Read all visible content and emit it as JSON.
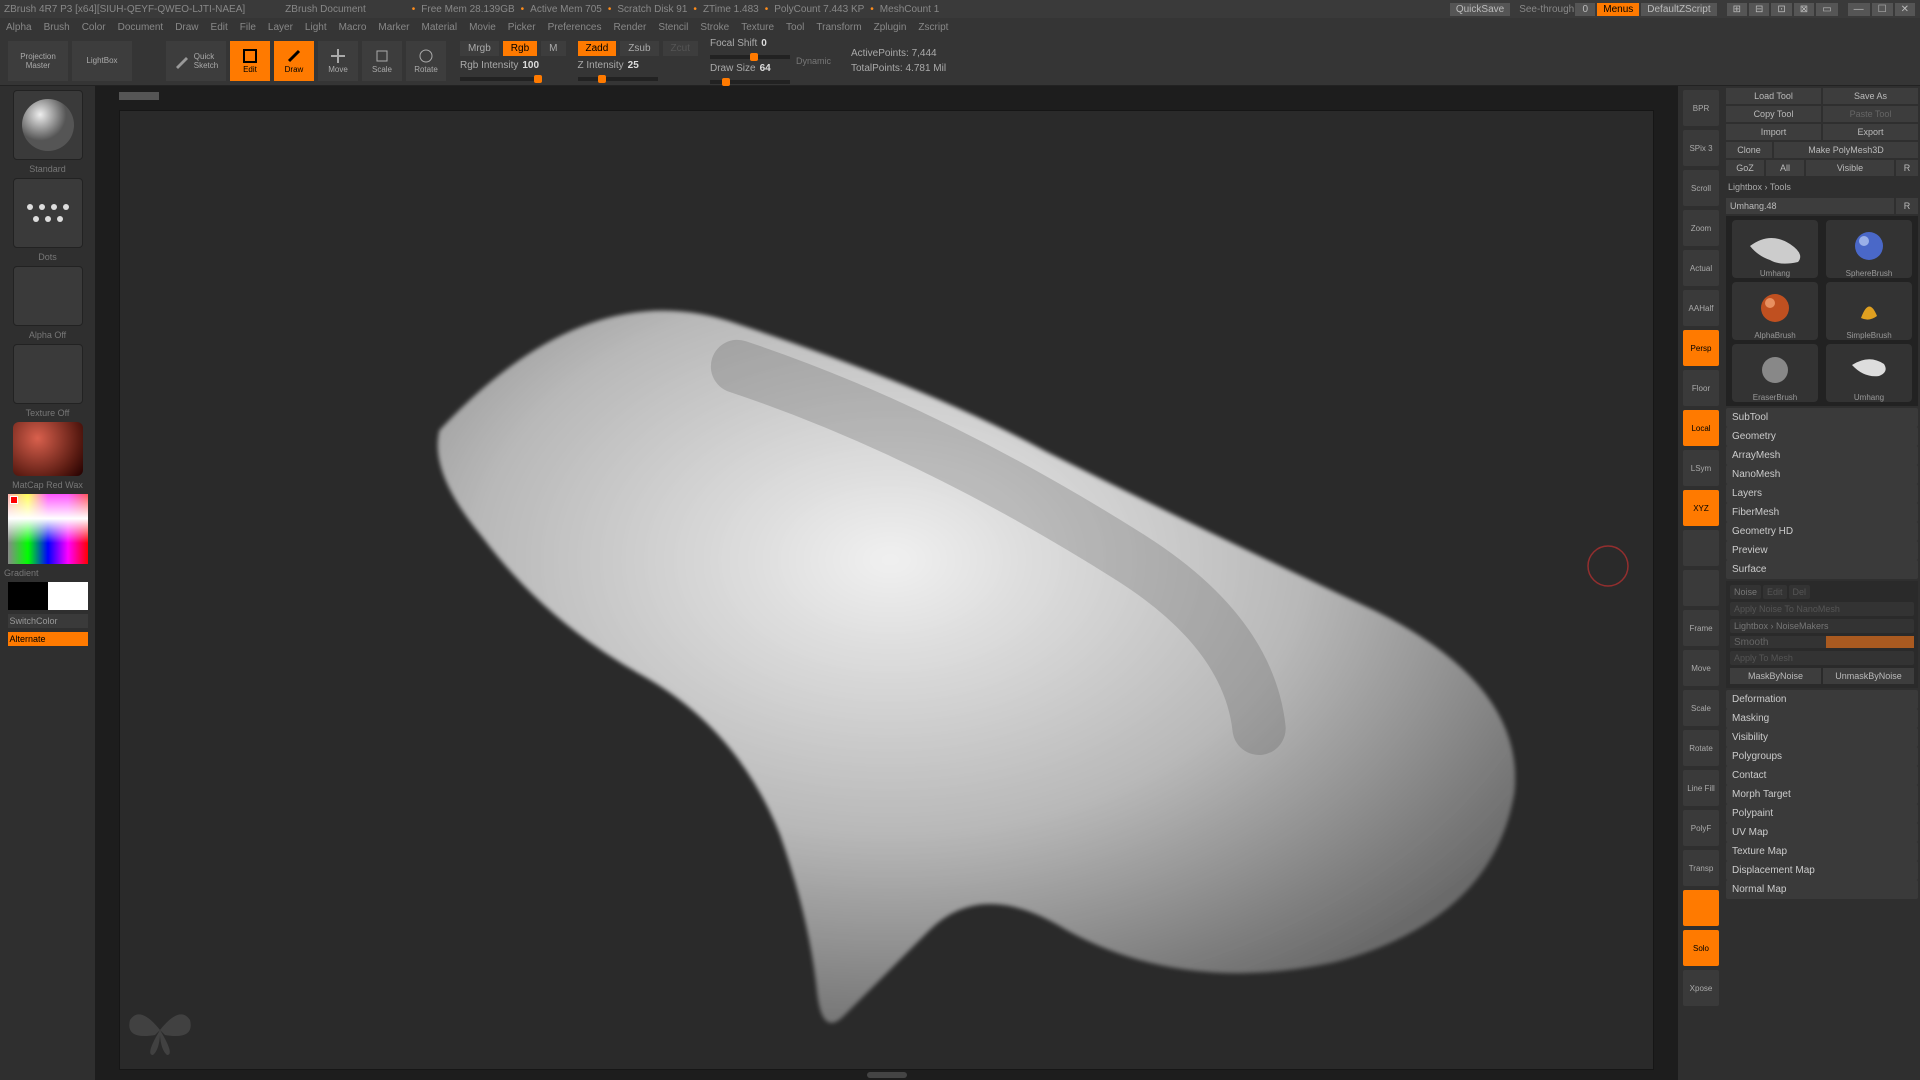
{
  "title": {
    "app": "ZBrush 4R7 P3 [x64][SIUH-QEYF-QWEO-LJTI-NAEA]",
    "doc": "ZBrush Document",
    "stats": [
      "Free Mem 28.139GB",
      "Active Mem 705",
      "Scratch Disk 91",
      "ZTime 1.483",
      "PolyCount 7.443 KP",
      "MeshCount 1"
    ]
  },
  "top_right": {
    "quicksave": "QuickSave",
    "seethrough": "See-through",
    "seethrough_val": "0",
    "menus": "Menus",
    "script": "DefaultZScript"
  },
  "menus": [
    "Alpha",
    "Brush",
    "Color",
    "Document",
    "Draw",
    "Edit",
    "File",
    "Layer",
    "Light",
    "Macro",
    "Marker",
    "Material",
    "Movie",
    "Picker",
    "Preferences",
    "Render",
    "Stencil",
    "Stroke",
    "Texture",
    "Tool",
    "Transform",
    "Zplugin",
    "Zscript"
  ],
  "toolbar": {
    "projection": "Projection\nMaster",
    "lightbox": "LightBox",
    "quicksketch": "Quick\nSketch",
    "edit": "Edit",
    "draw": "Draw",
    "move": "Move",
    "scale": "Scale",
    "rotate": "Rotate",
    "mrgb": "Mrgb",
    "rgb": "Rgb",
    "m": "M",
    "rgb_int": "Rgb Intensity",
    "rgb_int_val": "100",
    "zadd": "Zadd",
    "zsub": "Zsub",
    "zcut": "Zcut",
    "z_int": "Z Intensity",
    "z_int_val": "25",
    "focal": "Focal Shift",
    "focal_val": "0",
    "draw_size": "Draw Size",
    "draw_size_val": "64",
    "dynamic": "Dynamic",
    "active": "ActivePoints:",
    "active_val": "7,444",
    "total": "TotalPoints:",
    "total_val": "4.781 Mil"
  },
  "left": {
    "brush": "Standard",
    "stroke": "Dots",
    "alpha": "Alpha Off",
    "texture": "Texture Off",
    "material": "MatCap Red Wax",
    "gradient": "Gradient",
    "switchcolor": "SwitchColor",
    "alternate": "Alternate"
  },
  "rstrip": [
    "BPR",
    "SPix 3",
    "Scroll",
    "Zoom",
    "Actual",
    "AAHalf",
    "Persp",
    "Floor",
    "Local",
    "LSym",
    "XYZ",
    "",
    "",
    "Frame",
    "Move",
    "Scale",
    "Rotate",
    "Line Fill",
    "PolyF",
    "Transp",
    "",
    "Solo",
    "Xpose"
  ],
  "rstrip_on": [
    false,
    false,
    false,
    false,
    false,
    false,
    true,
    false,
    true,
    false,
    true,
    false,
    false,
    false,
    false,
    false,
    false,
    false,
    false,
    false,
    true,
    true,
    false
  ],
  "panel": {
    "load": "Load Tool",
    "saveas": "Save As",
    "copy": "Copy Tool",
    "paste": "Paste Tool",
    "import": "Import",
    "export": "Export",
    "clone": "Clone",
    "makepoly": "Make PolyMesh3D",
    "goz": "GoZ",
    "all": "All",
    "visible": "Visible",
    "r": "R",
    "lb_tools": "Lightbox › Tools",
    "cur_tool": "Umhang.48",
    "thumbs": [
      "Umhang",
      "SphereBrush",
      "AlphaBrush",
      "SimpleBrush",
      "EraserBrush",
      "Umhang"
    ],
    "sections": [
      "SubTool",
      "Geometry",
      "ArrayMesh",
      "NanoMesh",
      "Layers",
      "FiberMesh",
      "Geometry HD",
      "Preview",
      "Surface"
    ],
    "surface": {
      "noise": "Noise",
      "edit": "Edit",
      "del": "Del",
      "apply_nano": "Apply Noise To NanoMesh",
      "lb_noise": "Lightbox › NoiseMakers",
      "smooth": "Smooth",
      "apply_mesh": "Apply To Mesh",
      "maskby": "MaskByNoise",
      "unmaskby": "UnmaskByNoise"
    },
    "sections2": [
      "Deformation",
      "Masking",
      "Visibility",
      "Polygroups",
      "Contact",
      "Morph Target",
      "Polypaint",
      "UV Map",
      "Texture Map",
      "Displacement Map",
      "Normal Map"
    ]
  }
}
